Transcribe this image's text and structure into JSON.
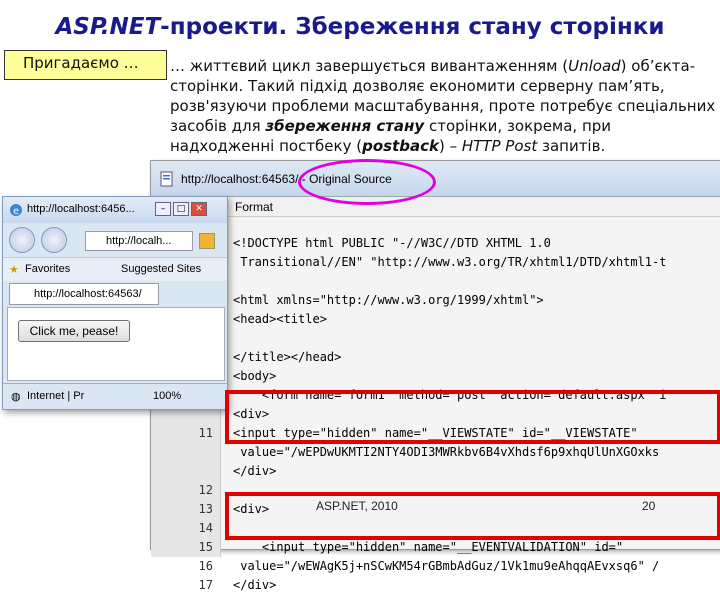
{
  "slide": {
    "title_part1": "ASP.NET",
    "title_part2": "-проекти. Збереження стану сторінки",
    "remind_label": "Пригадаємо …",
    "text": {
      "p1": "… життєвий цикл завершується вивантаженням (",
      "unload": "Unload",
      "p2": ") об’єкта-сторінки. Такий підхід дозволяє економити серверну пам’ять, розв'язуючи проблеми масштабування, проте потребує спеціальних засобів для ",
      "state": "збереження стану",
      "p3": " сторінки, зокрема, при надходженні постбеку (",
      "postback": "postback",
      "p4": ") – ",
      "http_post": "HTTP Post",
      "p5": " запитів."
    },
    "footer_left": "ASP.NET, 2010",
    "footer_right": "20"
  },
  "source_window": {
    "address": "http://localhost:64563/ - Original Source",
    "menu": "Format",
    "lines": [
      {
        "n": "",
        "code": "<!DOCTYPE html PUBLIC \"-//W3C//DTD XHTML 1.0"
      },
      {
        "n": "",
        "code": " Transitional//EN\" \"http://www.w3.org/TR/xhtml1/DTD/xhtml1-t"
      },
      {
        "n": "",
        "code": ""
      },
      {
        "n": "",
        "code": "<html xmlns=\"http://www.w3.org/1999/xhtml\">"
      },
      {
        "n": "",
        "code": "<head><title>"
      },
      {
        "n": "",
        "code": ""
      },
      {
        "n": "",
        "code": "</title></head>"
      },
      {
        "n": "",
        "code": "<body>"
      },
      {
        "n": "",
        "code": "    <form name=\"form1\" method=\"post\" action=\"default.aspx\" i"
      },
      {
        "n": "",
        "code": "<div>"
      },
      {
        "n": "11",
        "code": "<input type=\"hidden\" name=\"__VIEWSTATE\" id=\"__VIEWSTATE\""
      },
      {
        "n": "",
        "code": " value=\"/wEPDwUKMTI2NTY4ODI3MWRkbv6B4vXhdsf6p9xhqUlUnXGOxks"
      },
      {
        "n": "",
        "code": "</div>"
      },
      {
        "n": "12",
        "code": ""
      },
      {
        "n": "13",
        "code": "<div>"
      },
      {
        "n": "14",
        "code": ""
      },
      {
        "n": "15",
        "code": "    <input type=\"hidden\" name=\"__EVENTVALIDATION\" id=\""
      },
      {
        "n": "16",
        "code": " value=\"/wEWAgK5j+nSCwKM54rGBmbAdGuz/1Vk1mu9eAhqqAEvxsq6\" /"
      },
      {
        "n": "17",
        "code": "</div>"
      }
    ]
  },
  "small_window": {
    "title": "http://localhost:6456...",
    "address": "http://localh...",
    "favorites": "Favorites",
    "suggested": "Suggested Sites",
    "tab": "http://localhost:64563/",
    "button": "Click me, pease!",
    "status_zone": "Internet | Pr",
    "zoom": "100%"
  }
}
